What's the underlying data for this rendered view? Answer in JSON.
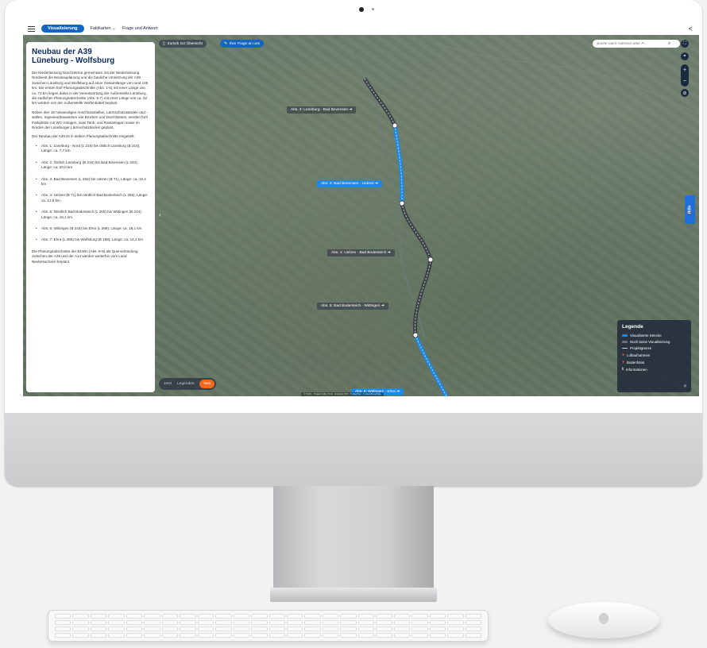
{
  "app": {
    "nav": {
      "active": "Visualisierung",
      "items": [
        "Faktkarten",
        "Frage und Antwort"
      ]
    }
  },
  "sidebar": {
    "title": "Neubau der A39",
    "subtitle": "Lüneburg - Wolfsburg",
    "paragraphs": [
      "Die Niederlassung Nord betreut gemeinsam mit der Niederlassung Nordwest die Neubauplanung und die bauliche Umsetzung der A39 zwischen Lüneburg und Wolfsburg auf einer Gesamtlänge von rund 105 km. Die ersten fünf Planungsabschnitte (Abs. 1-5) mit einer Länge von ca. 73 km liegen dabei in der Verantwortung der Außenstelle Lüneburg, die südlichen Planungsabschnitte (Abs. 6-7) mit einer Länge von ca. 32 km werden von der Außenstelle Wolfenbüttel beplant.",
      "Neben den 18 notwendigen Anschlussstellen, Lärmschutzwänden und -wällen, Ingenieurbauwerken wie Brücken und Durchlässen, werden fünf Parkplätze mit WC-Anlagen, zwei Tank- und Rastanlagen sowie im Norden der Lüneburger Lärmschutzdeckel geplant.",
      "Der Neubau der A39 ist in sieben Planungsabschnitte eingeteilt:"
    ],
    "sections": [
      "Abs. 1: Lüneburg - Nord (L 216) bis östlich Lüneburg (B 216), Länge: ca. 7,7 km",
      "Abs. 2: Östlich Lüneburg (B 216) bis Bad Bevensen (L 253), Länge: ca. 20,0 km",
      "Abs. 3: Bad Bevensen (L 253) bis Uelzen (B 71), Länge: ca. 16,4 km",
      "Abs. 4: Uelzen (B 71) bis nördlich Bad Bodenteich (L 265), Länge: ca. 12,6 km",
      "Abs. 5: Nördlich Bad Bodenteich (L 265) bis Wittingen (B 244), Länge: ca. 16,1 km",
      "Abs. 6: Wittingen (B 244) bis Ehra (L 289), Länge: ca. 18,1 km",
      "Abs. 7: Ehra (L 289) bis Wolfsburg (B 188), Länge: ca. 14,2 km"
    ],
    "footer": "Die Planungsabschnitte der B190n (Abs. 8-9) als Querverbindung zwischen der A39 und der A14 werden weiterhin vom Land Niedersachsen beplant."
  },
  "toolbar": {
    "back_label": "Zurück zur Übersicht",
    "ask_label": "Ihre Frage an uns",
    "search_placeholder": "Suche nach Adresse oder P..."
  },
  "map_labels": {
    "abs2": "Abs. 2: Lüneburg - Bad Bevensen ➔",
    "abs3": "Abs. 3: Bad Bevensen - Uelzen ➔",
    "abs4": "Abs. 4: Uelzen - Bad Bodenteich ➔",
    "abs5": "Abs. 5: Bad Bodenteich - Wittingen ➔",
    "abs6": "Abs. 6: Wittingen - Ehra ➔"
  },
  "help_tab": "Hilfe",
  "legend": {
    "title": "Legende",
    "items": [
      {
        "label": "Visualisierte Strecke",
        "color": "#1e88e5"
      },
      {
        "label": "Noch keine Visualisierung",
        "color": "#6b7077"
      },
      {
        "label": "Projektgrenze",
        "color": "#cfd3d8"
      },
      {
        "label": "Luftaufnahmen",
        "color": "#f06a1d"
      },
      {
        "label": "Bodenfotos",
        "color": "#e54848"
      },
      {
        "label": "Informationen",
        "color": "#ffffff"
      }
    ]
  },
  "timeline": {
    "items": [
      "Jetzt",
      "Legenden"
    ],
    "active": "Neu"
  },
  "attribution": "© TUDC · Projekt: Hilfe | FCE · Kontakt | PFP · ® MapTiler · © OpenStreetMap",
  "colors": {
    "primary": "#1565c0",
    "accent": "#f06a1d",
    "route_done": "#1e88e5",
    "route_pending": "#555b62"
  }
}
